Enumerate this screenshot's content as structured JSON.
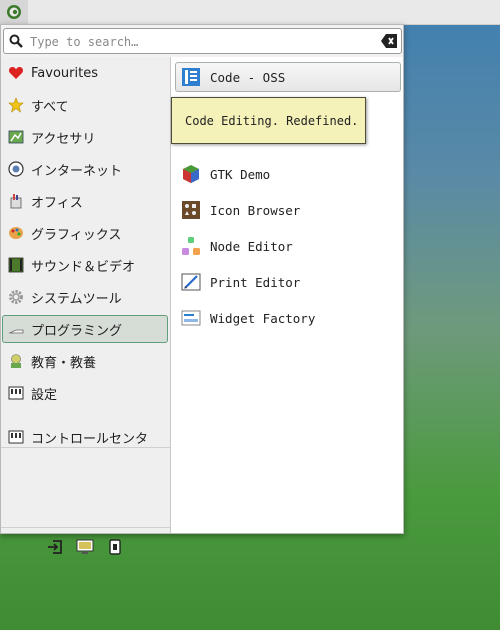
{
  "topbar": {
    "whisker_icon": "whisker-menu-icon"
  },
  "search": {
    "placeholder": "Type to search…",
    "value": ""
  },
  "categories": [
    {
      "label": "Favourites",
      "icon": "heart-icon"
    },
    {
      "label": "すべて",
      "icon": "star-icon"
    },
    {
      "label": "アクセサリ",
      "icon": "accessories-icon"
    },
    {
      "label": "インターネット",
      "icon": "globe-icon"
    },
    {
      "label": "オフィス",
      "icon": "office-icon"
    },
    {
      "label": "グラフィックス",
      "icon": "palette-icon"
    },
    {
      "label": "サウンド＆ビデオ",
      "icon": "film-icon"
    },
    {
      "label": "システムツール",
      "icon": "gear-icon"
    },
    {
      "label": "プログラミング",
      "icon": "programming-icon",
      "selected": true
    },
    {
      "label": "教育・教養",
      "icon": "education-icon"
    },
    {
      "label": "設定",
      "icon": "settings-icon"
    },
    {
      "label": "コントロールセンタ",
      "icon": "control-center-icon"
    }
  ],
  "apps": [
    {
      "label": "Code - OSS",
      "icon": "code-oss-icon",
      "hover": true
    },
    {
      "label": "GTK Demo",
      "icon": "gtk-icon"
    },
    {
      "label": "Icon Browser",
      "icon": "icon-browser-icon"
    },
    {
      "label": "Node Editor",
      "icon": "node-editor-icon"
    },
    {
      "label": "Print Editor",
      "icon": "print-editor-icon"
    },
    {
      "label": "Widget Factory",
      "icon": "widget-factory-icon"
    }
  ],
  "tooltip": {
    "text": "Code Editing. Redefined."
  },
  "bottom_actions": [
    {
      "icon": "log-out-icon"
    },
    {
      "icon": "lock-screen-icon"
    },
    {
      "icon": "switch-user-icon"
    }
  ]
}
